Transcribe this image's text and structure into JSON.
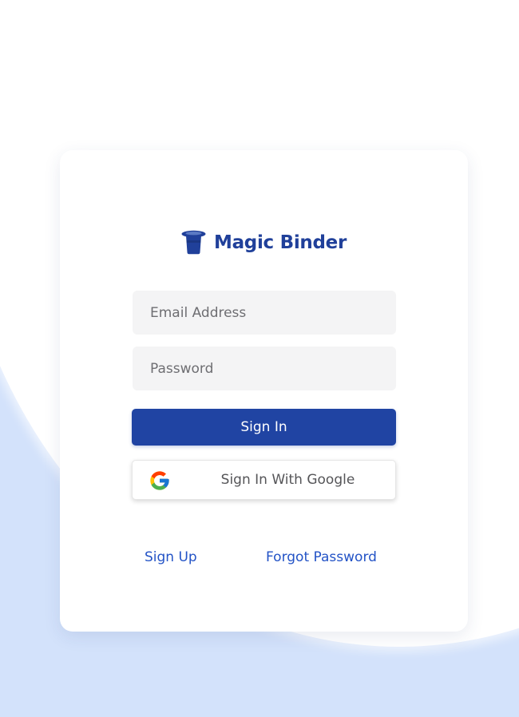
{
  "brand": {
    "name": "Magic Binder",
    "icon": "top-hat-icon",
    "color": "#20409a"
  },
  "form": {
    "email_placeholder": "Email Address",
    "password_placeholder": "Password",
    "email_value": "",
    "password_value": ""
  },
  "buttons": {
    "sign_in": "Sign In",
    "google_sign_in": "Sign In With Google",
    "google_icon": "google-g-icon"
  },
  "links": {
    "sign_up": "Sign Up",
    "forgot_password": "Forgot Password"
  },
  "colors": {
    "background": "#d3e2fb",
    "primary": "#2044a3",
    "link": "#2353c6"
  }
}
